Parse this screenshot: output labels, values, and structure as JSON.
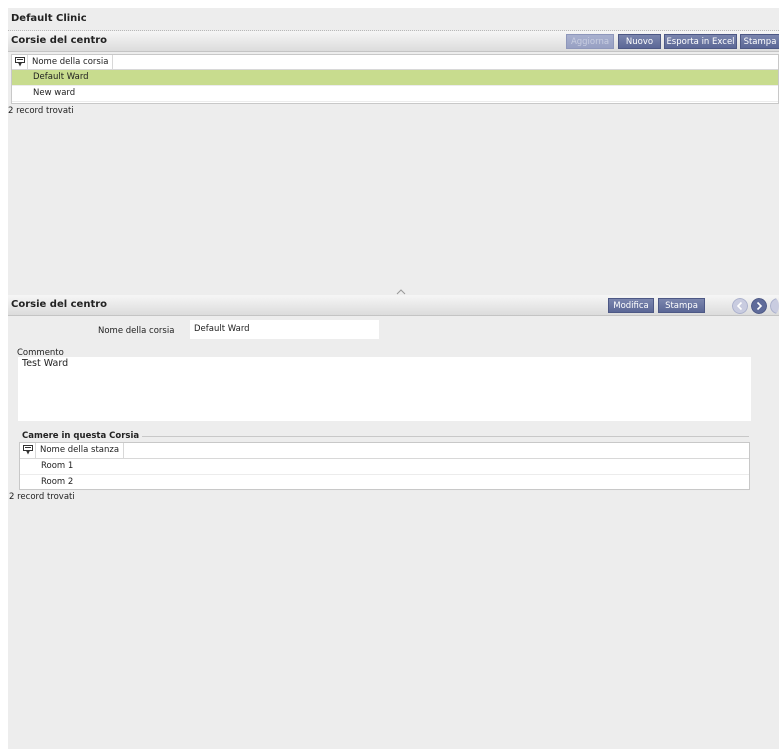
{
  "app": {
    "title": "Default Clinic"
  },
  "top_panel": {
    "title": "Corsie del centro",
    "buttons": {
      "refresh": "Aggiorna",
      "new": "Nuovo",
      "excel": "Esporta in Excel",
      "print": "Stampa"
    },
    "grid": {
      "column": "Nome della corsia",
      "rows": [
        "Default Ward",
        "New ward"
      ],
      "selected_row": 0
    },
    "count": "2 record trovati"
  },
  "detail_panel": {
    "title": "Corsie del centro",
    "buttons": {
      "edit": "Modifica",
      "print": "Stampa"
    },
    "name_label": "Nome della corsia",
    "name_value": "Default Ward",
    "comment_label": "Commento",
    "comment_value": "Test Ward",
    "rooms_section": "Camere in questa Corsia",
    "rooms_grid": {
      "column": "Nome della stanza",
      "rows": [
        "Room 1",
        "Room 2"
      ]
    },
    "rooms_count": "2 record trovati"
  },
  "colors": {
    "button": "#5f6b9a",
    "selected_row": "#c8dc8e",
    "background": "#ededed"
  },
  "icons": [
    "filter-icon",
    "chevron-up-icon",
    "prev-arrow-icon",
    "next-arrow-icon"
  ]
}
